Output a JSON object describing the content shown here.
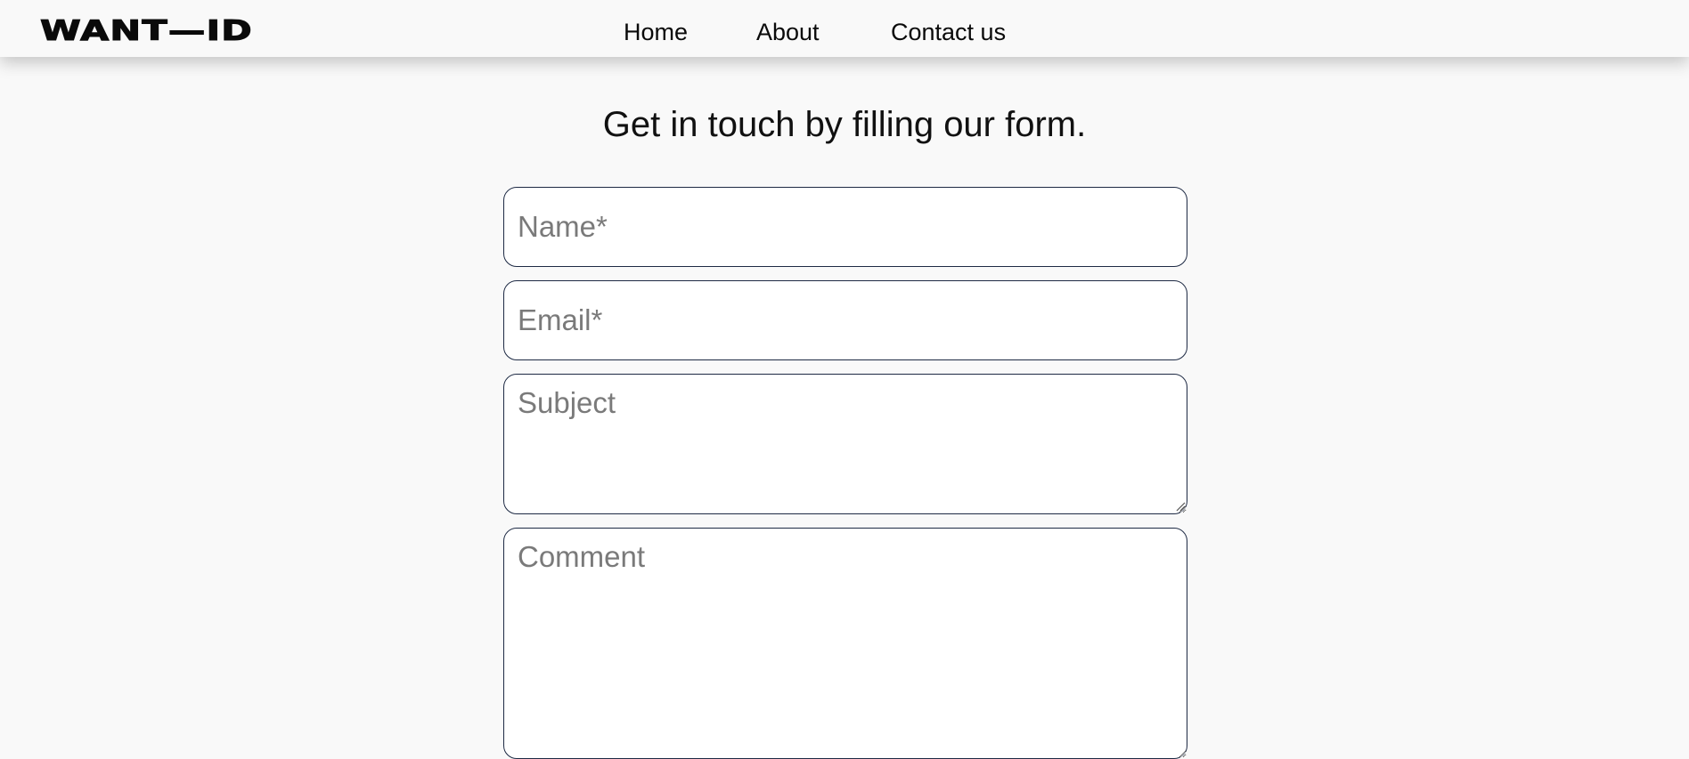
{
  "header": {
    "logo_text": "WANT—ID",
    "nav": [
      {
        "label": "Home"
      },
      {
        "label": "About"
      },
      {
        "label": "Contact us"
      }
    ]
  },
  "main": {
    "heading": "Get in touch by filling our form.",
    "form": {
      "name": {
        "placeholder": "Name*",
        "value": ""
      },
      "email": {
        "placeholder": "Email*",
        "value": ""
      },
      "subject": {
        "placeholder": "Subject",
        "value": ""
      },
      "comment": {
        "placeholder": "Comment",
        "value": ""
      }
    }
  },
  "colors": {
    "background": "#f9f9f9",
    "field_border": "#1e2a44",
    "text": "#111111",
    "placeholder": "#7a7a7a"
  }
}
